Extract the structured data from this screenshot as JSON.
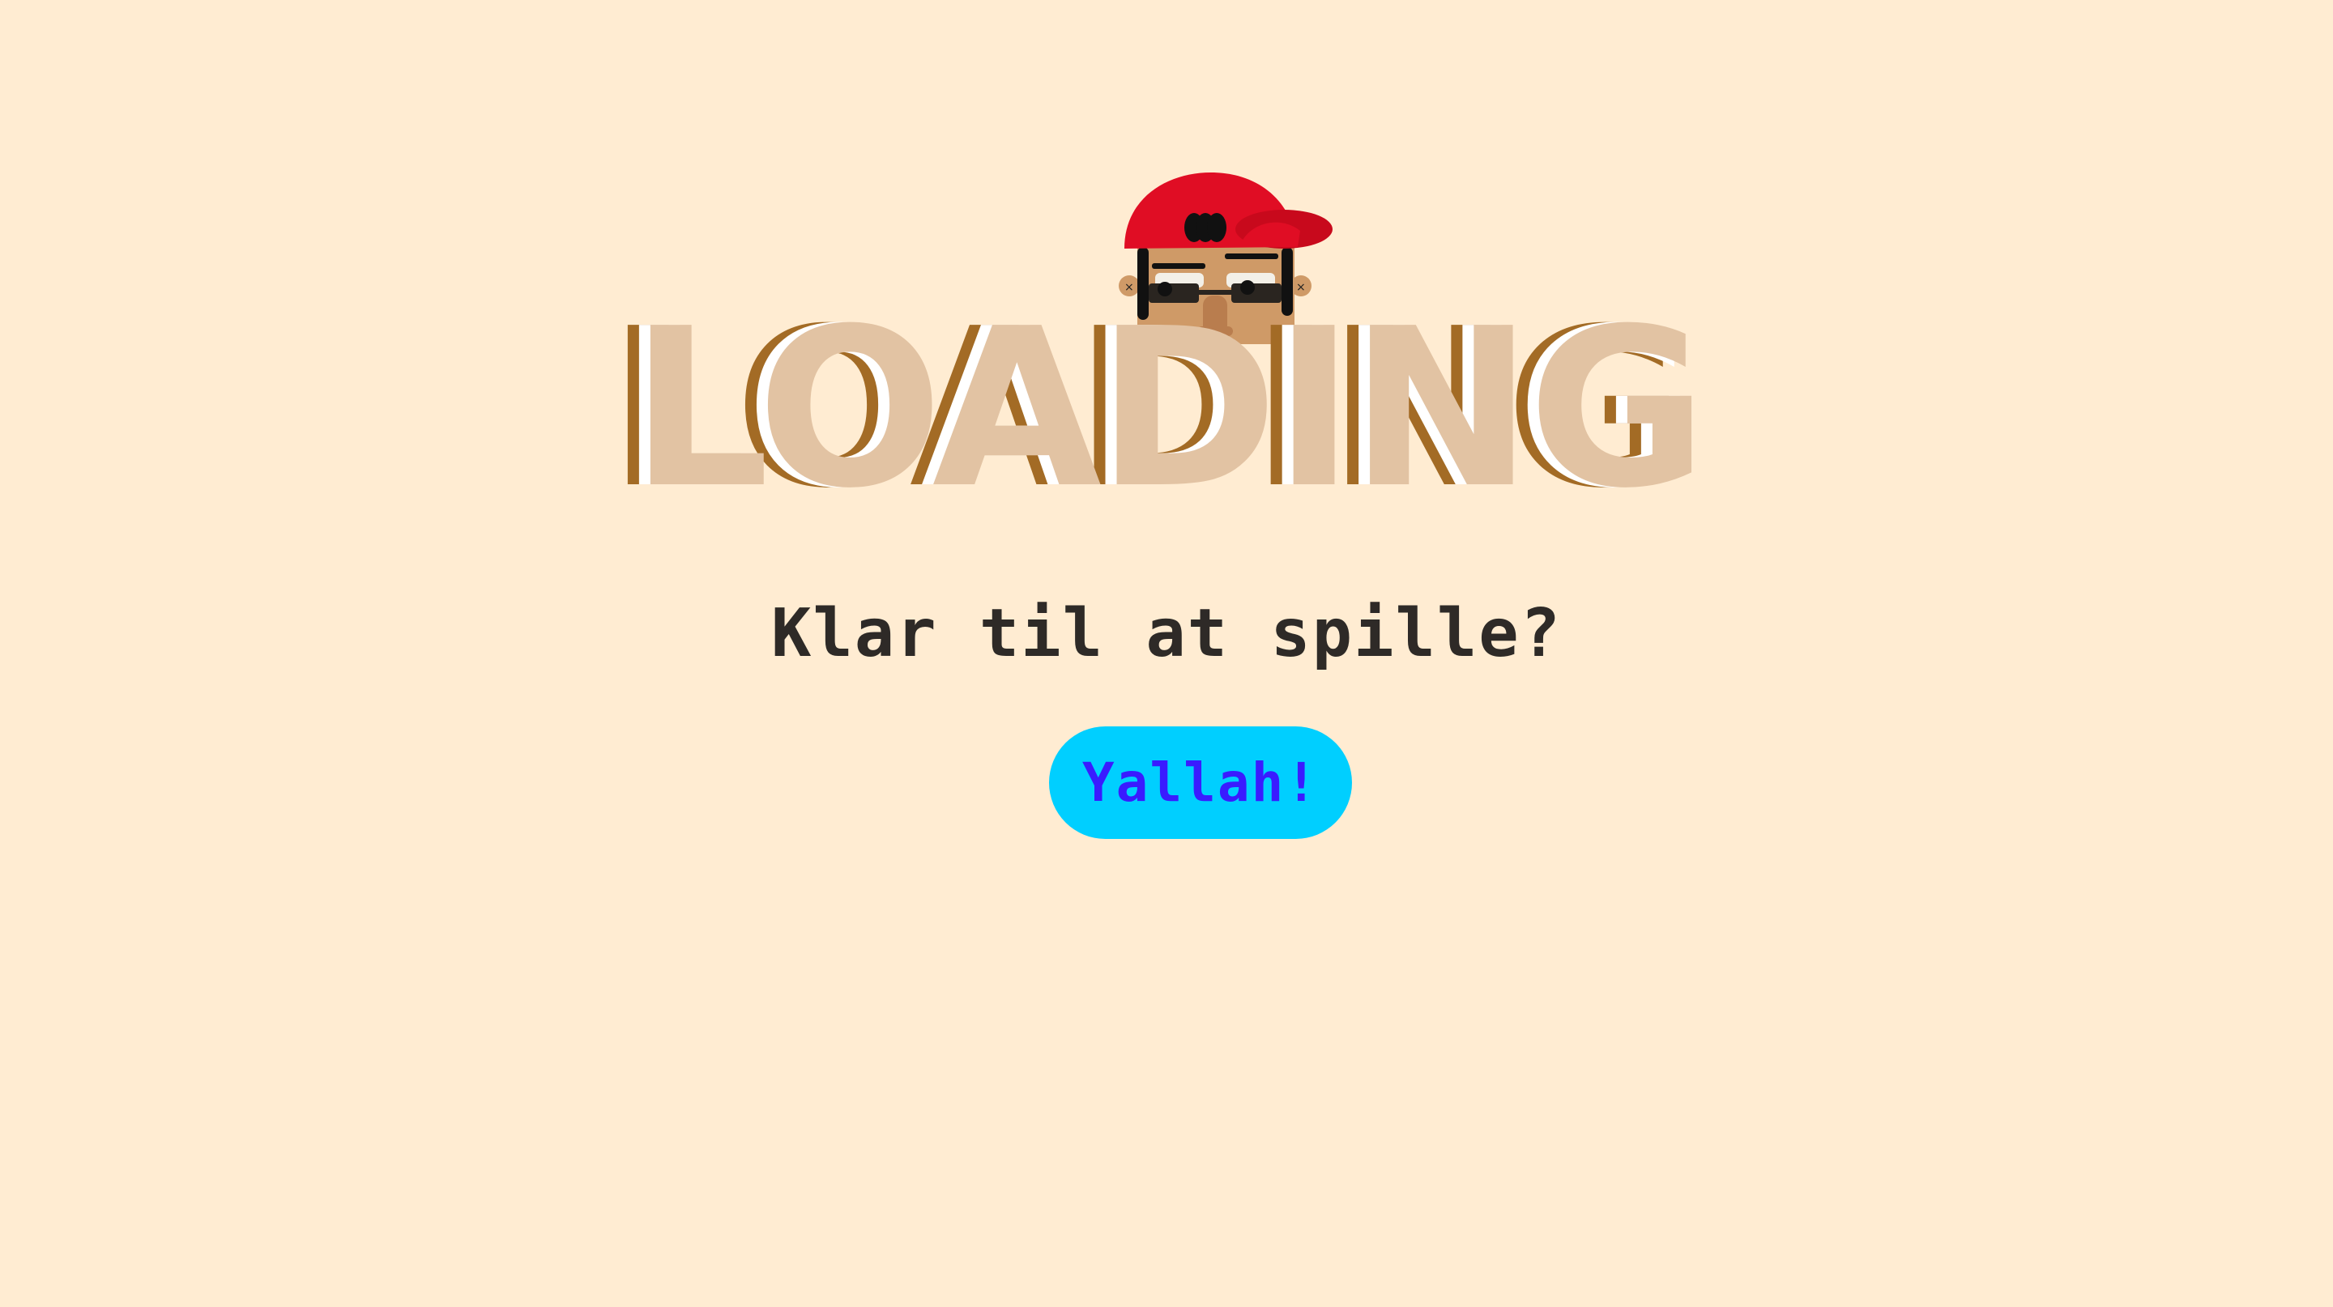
{
  "loading_screen": {
    "title": "LOADING",
    "prompt": "Klar til at spille?",
    "play_button_label": "Yallah!"
  },
  "character": {
    "icon": "character-avatar-icon",
    "cap_color": "#e00d24",
    "skin_color": "#cf9a67"
  },
  "colors": {
    "background": "#ffecd2",
    "title_face": "#e2c3a3",
    "title_shadow": "#a36b25",
    "prompt_text": "#2e2a27",
    "button_bg": "#00cfff",
    "button_text": "#3a1bff"
  }
}
